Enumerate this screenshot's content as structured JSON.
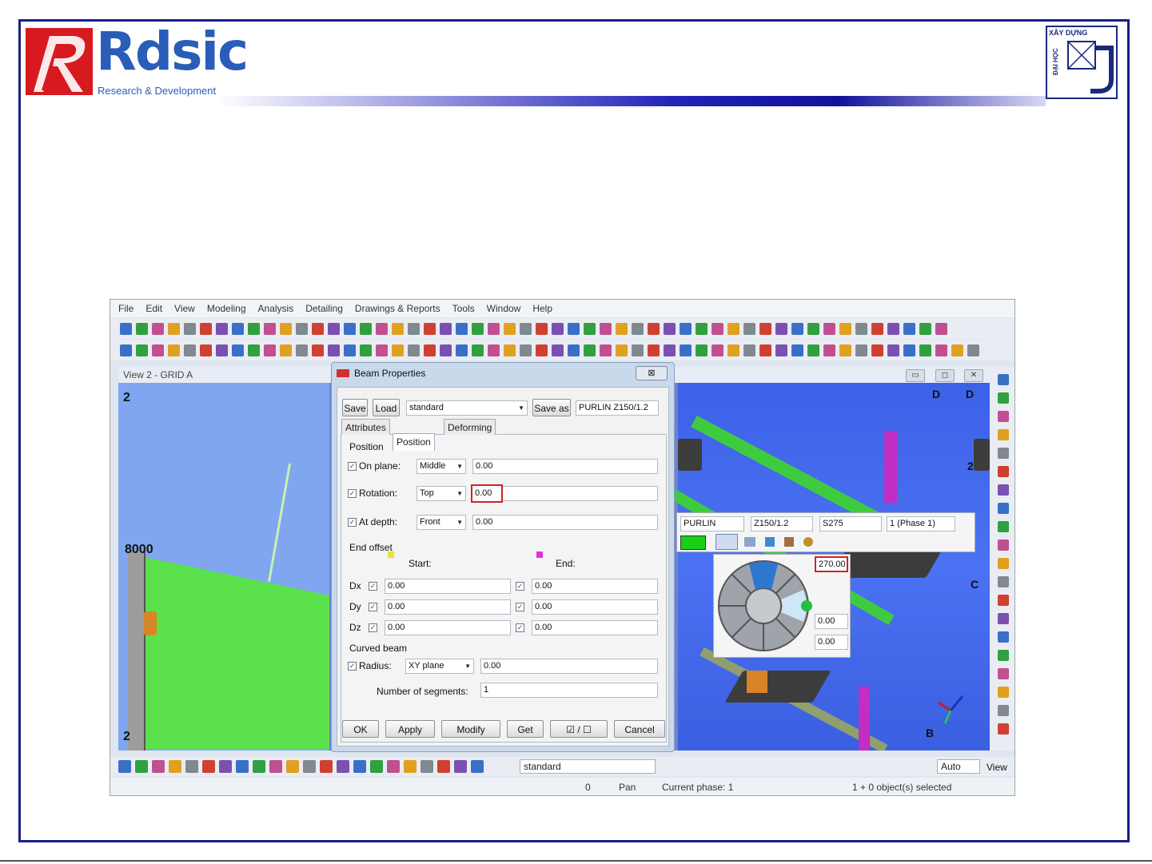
{
  "header": {
    "logo_main": "Rdsic",
    "logo_sub": "Research & Development",
    "uni_top": "XÂY DỰNG",
    "uni_side": "ĐẠI HỌC"
  },
  "menu": [
    "File",
    "Edit",
    "View",
    "Modeling",
    "Analysis",
    "Detailing",
    "Drawings & Reports",
    "Tools",
    "Window",
    "Help"
  ],
  "view": {
    "title": "View 2 - GRID A",
    "labels": {
      "grid_top": "2",
      "level": "8000",
      "grid_bottom": "2",
      "d1": "D",
      "d2": "D",
      "two": "2",
      "c": "C",
      "b": "B"
    }
  },
  "dialog": {
    "title": "Beam Properties",
    "close": "⊠",
    "save": "Save",
    "load": "Load",
    "preset": "standard",
    "save_as": "Save as",
    "save_as_name": "PURLIN Z150/1.2",
    "tabs": [
      "Attributes",
      "Position",
      "Deforming"
    ],
    "position_header": "Position",
    "on_plane_label": "On plane:",
    "on_plane_value": "Middle",
    "on_plane_num": "0.00",
    "rotation_label": "Rotation:",
    "rotation_value": "Top",
    "rotation_num": "0.00",
    "depth_label": "At depth:",
    "depth_value": "Front",
    "depth_num": "0.00",
    "end_offset_header": "End offset",
    "start_label": "Start:",
    "end_label": "End:",
    "dx": "Dx",
    "dy": "Dy",
    "dz": "Dz",
    "dx_start": "0.00",
    "dx_end": "0.00",
    "dy_start": "0.00",
    "dy_end": "0.00",
    "dz_start": "0.00",
    "dz_end": "0.00",
    "curved_header": "Curved beam",
    "radius_label": "Radius:",
    "radius_plane": "XY plane",
    "radius_value": "0.00",
    "segments_label": "Number of segments:",
    "segments_value": "1",
    "ok": "OK",
    "apply": "Apply",
    "modify": "Modify",
    "get": "Get",
    "toggle": "☑ / ☐",
    "cancel": "Cancel"
  },
  "popup": {
    "name": "PURLIN",
    "profile": "Z150/1.2",
    "material": "S275",
    "phase": "1 (Phase 1)",
    "angle": "270.00",
    "val1": "0.00",
    "val2": "0.00"
  },
  "bottombar": {
    "preset": "standard",
    "auto": "Auto",
    "view": "View"
  },
  "status": {
    "num": "0",
    "mode": "Pan",
    "phase": "Current phase: 1",
    "selected": "1 + 0 object(s) selected"
  },
  "colors": {
    "frame": "#1a1f8a",
    "brand_red": "#d71920",
    "brand_blue": "#2a5db8",
    "beam_green": "#3fcb3f"
  }
}
